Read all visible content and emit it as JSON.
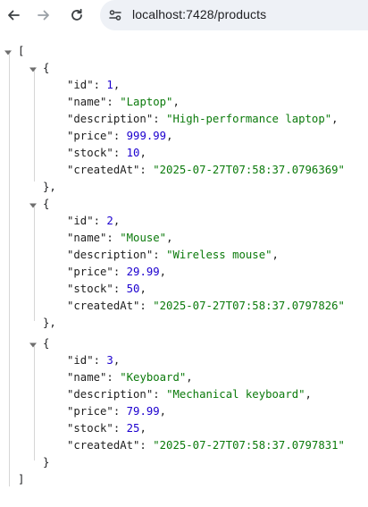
{
  "browser": {
    "url": "localhost:7428/products"
  },
  "json_view": {
    "open_bracket": "[",
    "close_bracket": "]",
    "items": [
      {
        "id": "1",
        "name": "\"Laptop\"",
        "description": "\"High-performance laptop\"",
        "price": "999.99",
        "stock": "10",
        "createdAt": "\"2025-07-27T07:58:37.0796369\"",
        "close": "},"
      },
      {
        "id": "2",
        "name": "\"Mouse\"",
        "description": "\"Wireless mouse\"",
        "price": "29.99",
        "stock": "50",
        "createdAt": "\"2025-07-27T07:58:37.0797826\"",
        "close": "},"
      },
      {
        "id": "3",
        "name": "\"Keyboard\"",
        "description": "\"Mechanical keyboard\"",
        "price": "79.99",
        "stock": "25",
        "createdAt": "\"2025-07-27T07:58:37.0797831\"",
        "close": "}"
      }
    ],
    "keys": {
      "id": "\"id\": ",
      "name": "\"name\": ",
      "description": "\"description\": ",
      "price": "\"price\": ",
      "stock": "\"stock\": ",
      "createdAt": "\"createdAt\": "
    },
    "open_brace": "{",
    "comma": ","
  }
}
